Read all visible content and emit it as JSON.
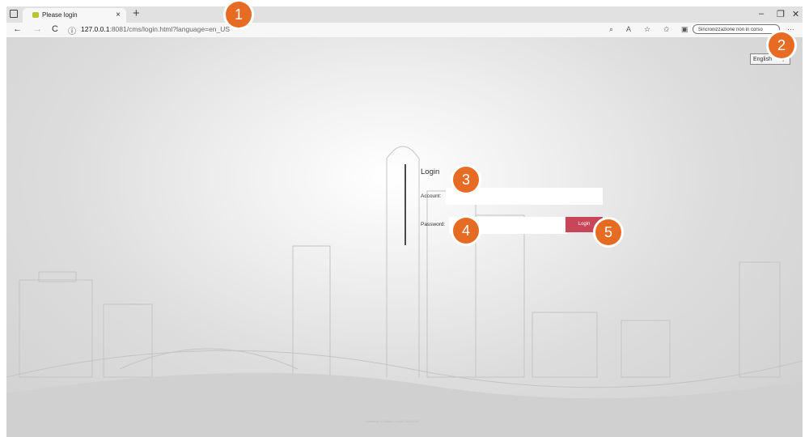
{
  "browser": {
    "tab_title": "Please login",
    "tab_close": "×",
    "new_tab": "+",
    "url_host": "127.0.0.1",
    "url_path": ":8081/cms/login.html?language=en_US",
    "sync_label": "Sincronizzazione non in corso",
    "minimize": "–",
    "restore": "❐",
    "close": "✕",
    "back": "←",
    "forward": "→",
    "refresh": "C",
    "info": "ⓘ",
    "more": "···"
  },
  "page": {
    "language_selected": "English",
    "login_title": "Login",
    "account_label": "Account:",
    "password_label": "Password:",
    "login_button": "Login",
    "footer": "Advertise 4.1Base-Ui-vle01-9542150"
  },
  "callouts": [
    "1",
    "2",
    "3",
    "4",
    "5"
  ],
  "colors": {
    "accent": "#e76c23",
    "login_button": "#c8465a"
  }
}
